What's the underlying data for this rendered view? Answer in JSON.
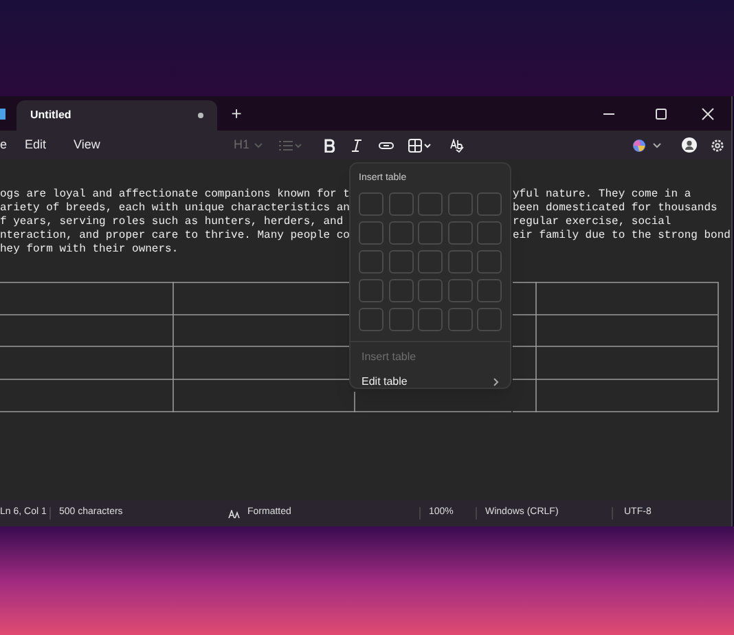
{
  "tab": {
    "title": "Untitled",
    "modified": true,
    "selected": true
  },
  "new_tab": {
    "label": "+"
  },
  "menu": [
    "e",
    "Edit",
    "View"
  ],
  "toolbar": {
    "heading": {
      "label": "H1",
      "disabled": true
    },
    "list": {
      "disabled": true
    }
  },
  "document": {
    "lines": [
      {
        "left": "ogs are loyal and affectionate companions known for t",
        "right": "yful nature. They come in a"
      },
      {
        "left": "ariety of breeds, each with unique characteristics an",
        "right": "been domesticated for thousands"
      },
      {
        "left": "f years, serving roles such as hunters, herders, and",
        "right": "regular exercise, social"
      },
      {
        "left": "nteraction, and proper care to thrive. Many people co",
        "right": "eir family due to the strong bond"
      },
      {
        "left": "hey form with their owners."
      }
    ]
  },
  "table_popup": {
    "title": "Insert table",
    "items": [
      {
        "label": "Insert table",
        "disabled": true,
        "submenu": false
      },
      {
        "label": "Edit table",
        "disabled": false,
        "submenu": true
      }
    ]
  },
  "status_bar": {
    "position": "Ln 6, Col 1",
    "characters": "500 characters",
    "format": "Formatted",
    "zoom": "100%",
    "line_ending": "Windows (CRLF)",
    "encoding": "UTF-8"
  }
}
